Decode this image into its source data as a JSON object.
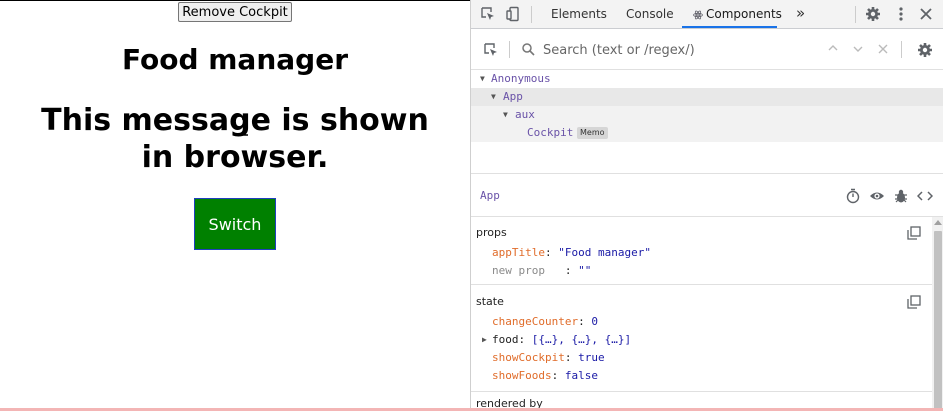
{
  "app": {
    "remove_button": "Remove Cockpit",
    "title": "Food manager",
    "message": "This message is shown in browser.",
    "switch_button": "Switch",
    "switch_color": "#008000"
  },
  "devtools": {
    "tabs": {
      "elements": "Elements",
      "console": "Console",
      "components": "Components",
      "components_icon": "react-icon",
      "more": "»"
    },
    "search": {
      "placeholder": "Search (text or /regex/)"
    },
    "tree": {
      "nodes": [
        {
          "label": "Anonymous"
        },
        {
          "label": "App"
        },
        {
          "label": "aux"
        },
        {
          "label": "Cockpit",
          "badge": "Memo"
        }
      ]
    },
    "inspector": {
      "component": "App",
      "props_title": "props",
      "props": [
        {
          "key": "appTitle",
          "value": "\"Food manager\""
        },
        {
          "key": "new prop",
          "value": "\"\""
        }
      ],
      "state_title": "state",
      "state": [
        {
          "key": "changeCounter",
          "value": "0"
        },
        {
          "key": "food",
          "value": "[{…}, {…}, {…}]"
        },
        {
          "key": "showCockpit",
          "value": "true"
        },
        {
          "key": "showFoods",
          "value": "false"
        }
      ],
      "rendered_by_title": "rendered by"
    },
    "colors": {
      "accent": "#1a73e8",
      "component_name": "#6a53a8",
      "prop_key": "#e06c2a",
      "value": "#1a1aa6"
    }
  }
}
